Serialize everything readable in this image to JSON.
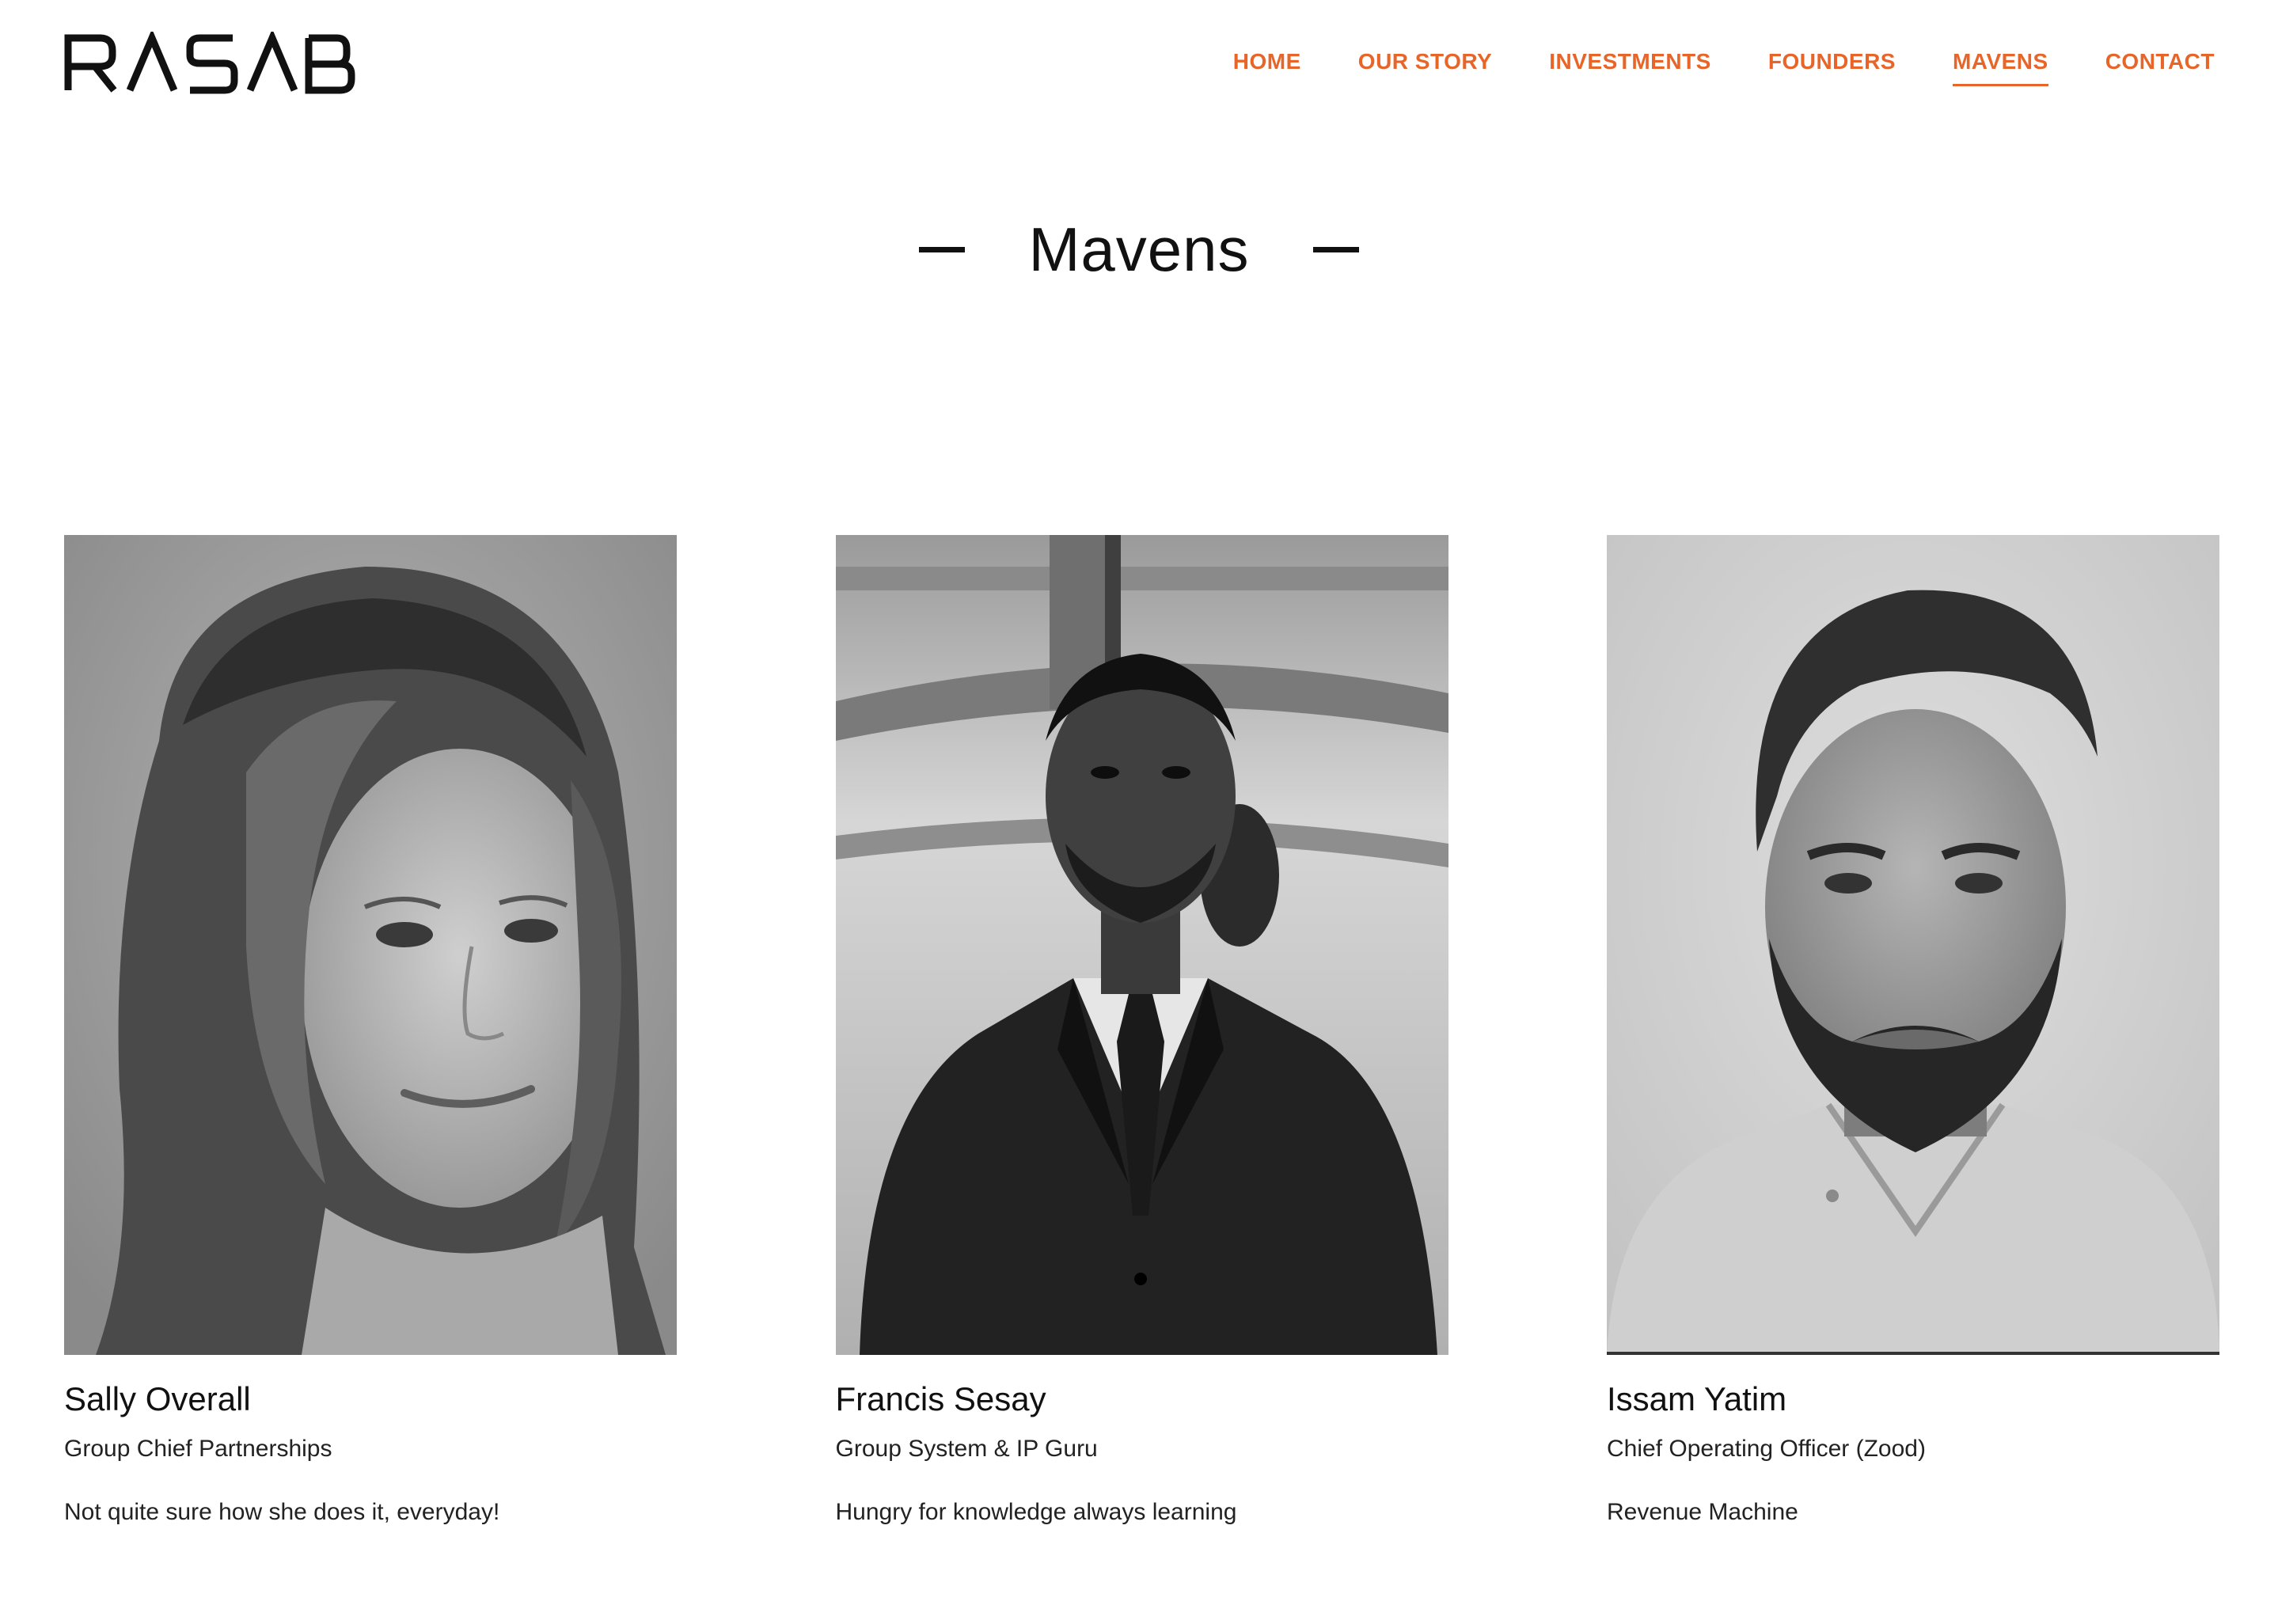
{
  "brand": {
    "logo_text": "RASAB",
    "accent": "#e8652a"
  },
  "nav": {
    "items": [
      {
        "label": "HOME"
      },
      {
        "label": "OUR STORY"
      },
      {
        "label": "INVESTMENTS"
      },
      {
        "label": "FOUNDERS"
      },
      {
        "label": "MAVENS",
        "active": true
      },
      {
        "label": "CONTACT"
      }
    ]
  },
  "page": {
    "title": "Mavens"
  },
  "mavens": [
    {
      "name": "Sally Overall",
      "role": "Group Chief Partnerships",
      "bio": "Not quite sure how she does it, everyday!"
    },
    {
      "name": "Francis Sesay",
      "role": "Group System & IP Guru",
      "bio": "Hungry for knowledge always learning"
    },
    {
      "name": "Issam Yatim",
      "role": "Chief Operating Officer (Zood)",
      "bio": "Revenue Machine"
    }
  ]
}
